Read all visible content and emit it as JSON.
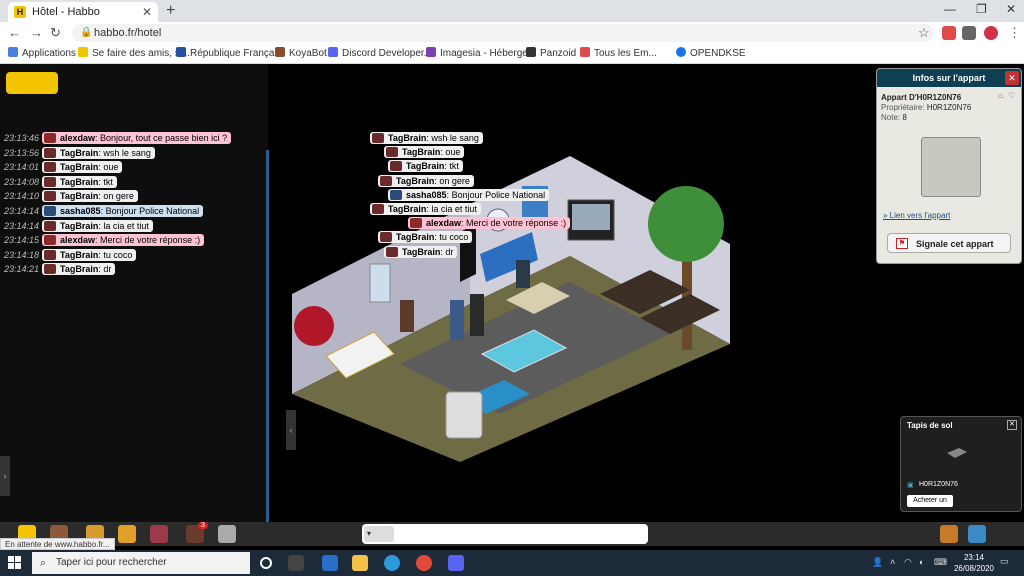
{
  "browser": {
    "tab_title": "Hôtel - Habbo",
    "tab_close": "✕",
    "new_tab": "+",
    "url": "habbo.fr/hotel",
    "bookmarks": [
      {
        "label": "Applications",
        "color": "#4a7de0"
      },
      {
        "label": "Se faire des amis, s'...",
        "color": "#f3c400"
      },
      {
        "label": "République Françai...",
        "color": "#2b4fa0"
      },
      {
        "label": "KoyaBot",
        "color": "#8a4b2a"
      },
      {
        "label": "Discord Developer...",
        "color": "#5865f2"
      },
      {
        "label": "Imagesia - Héberge...",
        "color": "#7a3fb0"
      },
      {
        "label": "Panzoid",
        "color": "#333333"
      },
      {
        "label": "Tous les Em...",
        "color": "#e04a4a"
      },
      {
        "label": "OPENDKSE",
        "color": "#1a73e8"
      }
    ]
  },
  "chatlog": {
    "lines": [
      {
        "time": "23:13:46",
        "user": "alexdaw",
        "text": "Bonjour, tout ce passe bien ici ?",
        "style": "pink"
      },
      {
        "time": "23:13:56",
        "user": "TagBrain",
        "text": "wsh le sang",
        "style": "white"
      },
      {
        "time": "23:14:01",
        "user": "TagBrain",
        "text": "oue",
        "style": "white"
      },
      {
        "time": "23:14:08",
        "user": "TagBrain",
        "text": "tkt",
        "style": "white"
      },
      {
        "time": "23:14:10",
        "user": "TagBrain",
        "text": "on gere",
        "style": "white"
      },
      {
        "time": "23:14:14",
        "user": "sasha085",
        "text": "Bonjour Police National",
        "style": "blue"
      },
      {
        "time": "23:14:14",
        "user": "TagBrain",
        "text": "la cia et tiut",
        "style": "white"
      },
      {
        "time": "23:14:15",
        "user": "alexdaw",
        "text": "Merci de votre réponse :)",
        "style": "pink"
      },
      {
        "time": "23:14:18",
        "user": "TagBrain",
        "text": "tu coco",
        "style": "white"
      },
      {
        "time": "23:14:21",
        "user": "TagBrain",
        "text": "dr",
        "style": "white"
      }
    ]
  },
  "room_chat": [
    {
      "user": "TagBrain",
      "text": "wsh le sang",
      "style": "white"
    },
    {
      "user": "TagBrain",
      "text": "oue",
      "style": "white"
    },
    {
      "user": "TagBrain",
      "text": "tkt",
      "style": "white"
    },
    {
      "user": "TagBrain",
      "text": "on gere",
      "style": "white"
    },
    {
      "user": "sasha085",
      "text": "Bonjour Police National",
      "style": "white"
    },
    {
      "user": "TagBrain",
      "text": "la cia et tiut",
      "style": "white"
    },
    {
      "user": "alexdaw",
      "text": "Merci de votre réponse :)",
      "style": "pink"
    },
    {
      "user": "TagBrain",
      "text": "tu coco",
      "style": "white"
    },
    {
      "user": "TagBrain",
      "text": "dr",
      "style": "white"
    }
  ],
  "room_info": {
    "header": "Infos sur l'appart",
    "close": "✕",
    "title": "Appart D'H0R1Z0N76",
    "owner_label": "Propriétaire:",
    "owner": "H0R1Z0N76",
    "rating_label": "Note:",
    "rating": "8",
    "link": "Lien vers l'appart",
    "report_button": "Signale cet appart"
  },
  "furni_info": {
    "title": "Tapis de sol",
    "close": "✕",
    "owner": "H0R1Z0N76",
    "buy_button": "Acheter un"
  },
  "toolbar": {
    "chat_style_label": "▾",
    "badge_count": "3"
  },
  "status_tip": "En attente de www.habbo.fr...",
  "taskbar": {
    "search_placeholder": "Taper ici pour rechercher",
    "time": "23:14",
    "date": "26/08/2020"
  }
}
